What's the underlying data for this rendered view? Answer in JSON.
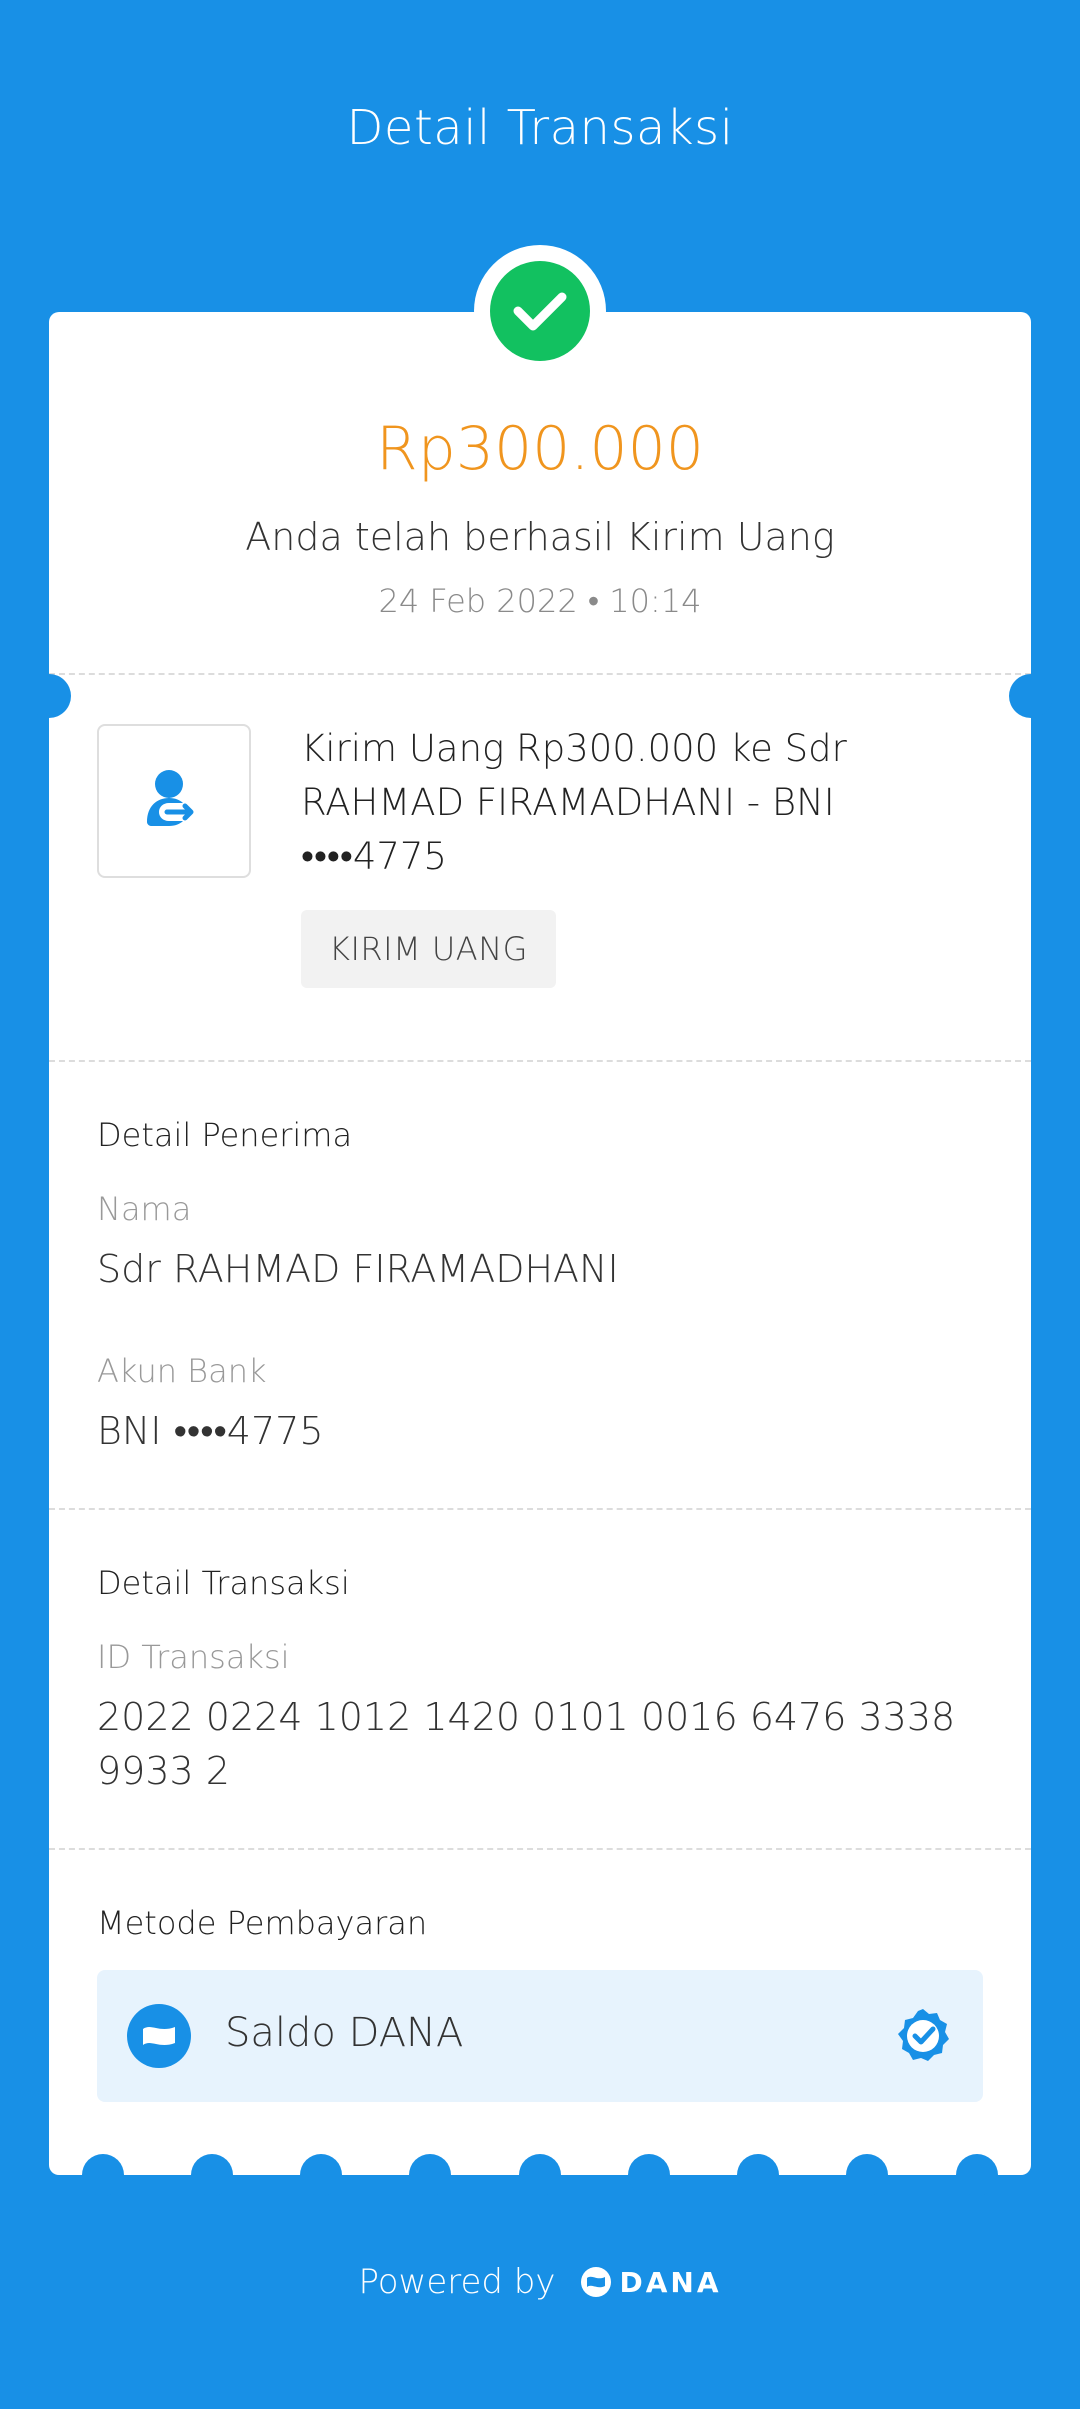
{
  "header": {
    "title": "Detail Transaksi"
  },
  "summary": {
    "amount": "Rp300.000",
    "message": "Anda telah berhasil Kirim Uang",
    "datetime": "24 Feb 2022 • 10:14"
  },
  "transaction": {
    "description": "Kirim Uang Rp300.000 ke Sdr RAHMAD FIRAMADHANI - BNI ••••4775",
    "tag": "KIRIM UANG",
    "icon": "send-money-icon"
  },
  "recipient": {
    "section_title": "Detail Penerima",
    "name_label": "Nama",
    "name_value": "Sdr RAHMAD FIRAMADHANI",
    "bank_label": "Akun Bank",
    "bank_value": "BNI ••••4775"
  },
  "details": {
    "section_title": "Detail Transaksi",
    "id_label": "ID Transaksi",
    "id_value": "2022 0224 1012 1420 0101 0016 6476 3338 9933 2"
  },
  "payment": {
    "section_title": "Metode Pembayaran",
    "method": "Saldo DANA",
    "icon": "dana-wallet-icon",
    "selected_icon": "check-badge-icon"
  },
  "footer": {
    "powered_by": "Powered by",
    "brand": "DANA"
  },
  "colors": {
    "background": "#1890e6",
    "amount": "#f0951e",
    "success": "#12c160"
  }
}
